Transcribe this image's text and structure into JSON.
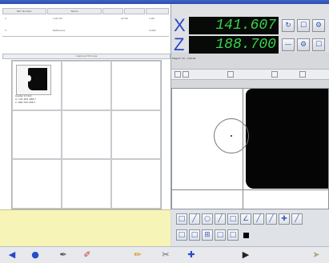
{
  "title": "",
  "list": {
    "columns": [
      "Part Number",
      "Name",
      "",
      "",
      ""
    ],
    "rows": [
      {
        "a": "1",
        "b": "1-01-03",
        "c": "",
        "d": "12:00",
        "e": "1.00"
      },
      {
        "a": "3",
        "b": "Reference",
        "c": "",
        "d": "",
        "e": "3.000"
      }
    ]
  },
  "gallery_bar": "Captured Pictures",
  "thumbnail": {
    "caption_lines": [
      "Center  X=0.0",
      "X:  141.607  188.7",
      "Y:  188.700  188.7"
    ]
  },
  "dro": {
    "x_axis": "X",
    "x_value": "141.607",
    "z_axis": "Z",
    "z_value": "188.700",
    "status": "Magnif: 1X - 100.00"
  },
  "toolbar_buttons": [
    "zoom-out",
    "zoom-in",
    "fit",
    "pan"
  ],
  "measure_tools": [
    "point",
    "line",
    "circle",
    "arc",
    "distance",
    "angle",
    "rect",
    "crosshair",
    "slope",
    "extra",
    "edge",
    "step",
    "grid",
    "box",
    "black-square"
  ],
  "taskbar": [
    "app-logo",
    "globe",
    "pen",
    "brush",
    "scissors",
    "scissors-2",
    "crosshair",
    "pointer",
    "cursor"
  ],
  "colors": {
    "dro_text": "#39d44a",
    "axis_label": "#2a48c8",
    "notes_bg": "#f7f4b8"
  }
}
